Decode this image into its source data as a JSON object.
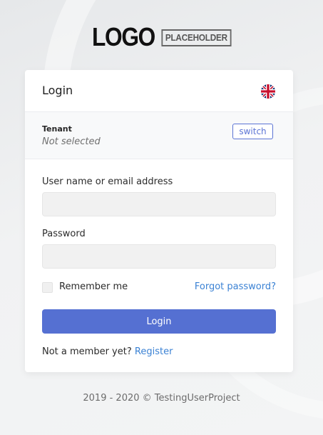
{
  "logo": {
    "word": "LOGO",
    "box": "PLACEHOLDER"
  },
  "card": {
    "title": "Login",
    "language_icon": "uk-flag-icon"
  },
  "tenant": {
    "label": "Tenant",
    "value": "Not selected",
    "switch_label": "switch"
  },
  "form": {
    "username_label": "User name or email address",
    "username_value": "",
    "password_label": "Password",
    "password_value": "",
    "remember_label": "Remember me",
    "remember_checked": false,
    "forgot_label": "Forgot password?",
    "submit_label": "Login",
    "register_prompt": "Not a member yet?",
    "register_link": "Register"
  },
  "footer": {
    "text": "2019 - 2020 © TestingUserProject"
  },
  "colors": {
    "primary": "#5570d2",
    "link": "#3b82d4",
    "switch_border": "#5b74d4"
  }
}
